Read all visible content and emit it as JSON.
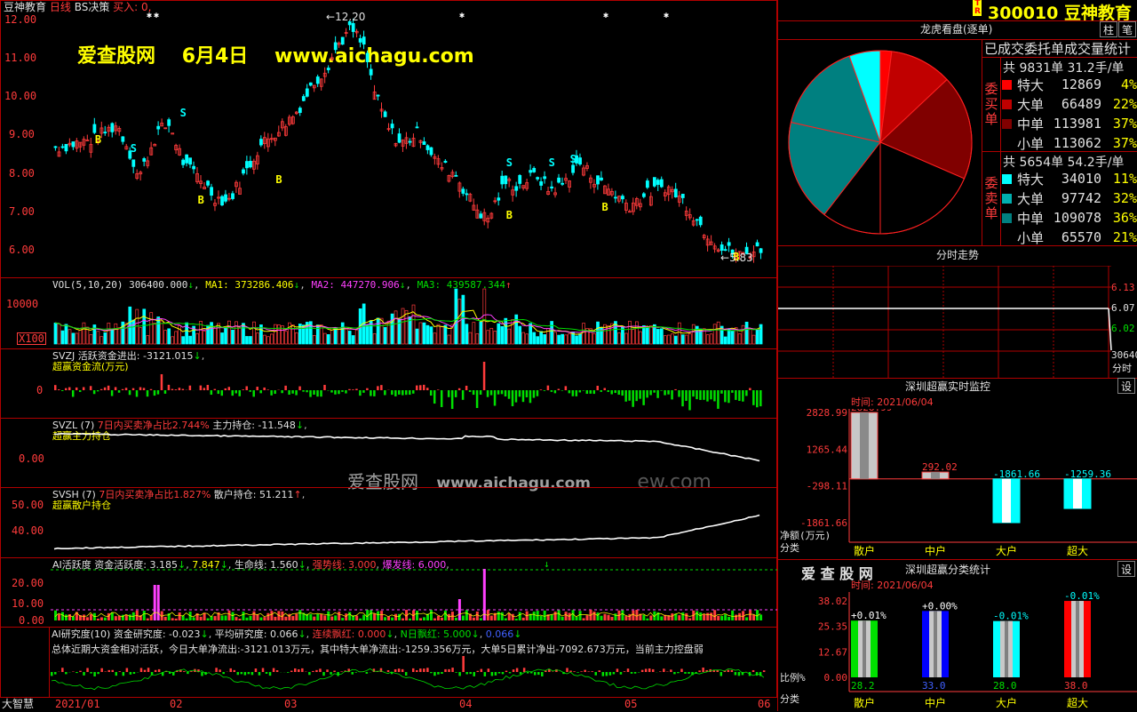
{
  "header": {
    "app": "豆神教育",
    "period": "日线",
    "indicator": "BS决策",
    "buy_label": "买入: 0,",
    "watermark_site": "爱查股网",
    "watermark_date": "6月4日",
    "watermark_url": "www.aichagu.com",
    "center_watermark_site": "爱查股网",
    "center_watermark_url": "www.aichagu.com",
    "center_watermark_tail": "ew.com"
  },
  "price_axis": [
    "12.00",
    "11.00",
    "10.00",
    "9.00",
    "8.00",
    "7.00",
    "6.00"
  ],
  "price_labels": {
    "high": "12.20",
    "low": "5.83"
  },
  "vol": {
    "title": "VOL(5,10,20)",
    "value": "306400.000",
    "ma1": "MA1: 373286.406",
    "ma2": "MA2: 447270.906",
    "ma3": "MA3: 439587.344",
    "axis_top": "10000",
    "axis_unit": "X100"
  },
  "svzj": {
    "title": "SVZJ",
    "label": "活跃资金进出: -3121.015",
    "sub": "超赢资金流(万元)",
    "axis": "0"
  },
  "svzl": {
    "title": "SVZL (7)",
    "ratio": "7日内买卖净占比2.744%",
    "hold": "主力持仓: -11.548",
    "sub": "超赢主力持仓",
    "axis": "0.00"
  },
  "svsh": {
    "title": "SVSH (7)",
    "ratio": "7日内买卖净占比1.827%",
    "hold": "散户持仓: 51.211",
    "sub": "超赢散户持仓",
    "axis": [
      "50.00",
      "40.00"
    ]
  },
  "ai": {
    "title": "AI活跃度",
    "activity": "资金活跃度: 3.185",
    "v2": "7.847",
    "life": "生命线: 1.560",
    "strong": "强势线: 3.000",
    "burst": "爆发线: 6.000",
    "axis": [
      "20.00",
      "10.00",
      "0.00"
    ]
  },
  "research": {
    "title": "AI研究度(10)",
    "deg": "资金研究度: -0.023",
    "avg": "平均研究度: 0.066",
    "lianxu": "连续飘红: 0.000",
    "nday": "N日飘红: 5.000",
    "val": "0.066",
    "summary": "总体近期大资金相对活跃，今日大单净流出:-3121.013万元，其中特大单净流出:-1259.356万元，大单5日累计净出-7092.673万元，当前主力控盘弱"
  },
  "date_axis": [
    "2021/01",
    "02",
    "03",
    "04",
    "05",
    "06"
  ],
  "brand": "大智慧",
  "right": {
    "code": "300010",
    "name": "豆神教育",
    "tab_label": "龙虎看盘(逐单)",
    "btn1": "柱",
    "btn2": "笔",
    "stats_title": "已成交委托单成交量统计",
    "buy_side": "委买单",
    "sell_side": "委卖单",
    "buy_total": "共 9831单 31.2手/单",
    "sell_total": "共 5654单 54.2手/单",
    "buy_rows": [
      {
        "name": "特大",
        "vol": "12869",
        "pct": "4%",
        "color": "#ff0000"
      },
      {
        "name": "大单",
        "vol": "66489",
        "pct": "22%",
        "color": "#c00000"
      },
      {
        "name": "中单",
        "vol": "113981",
        "pct": "37%",
        "color": "#800000"
      },
      {
        "name": "小单",
        "vol": "113062",
        "pct": "37%",
        "color": "#000000"
      }
    ],
    "sell_rows": [
      {
        "name": "特大",
        "vol": "34010",
        "pct": "11%",
        "color": "#00ffff"
      },
      {
        "name": "大单",
        "vol": "97742",
        "pct": "32%",
        "color": "#00b0b0"
      },
      {
        "name": "中单",
        "vol": "109078",
        "pct": "36%",
        "color": "#008080"
      },
      {
        "name": "小单",
        "vol": "65570",
        "pct": "21%",
        "color": "#000000"
      }
    ],
    "intraday": {
      "title": "分时走势",
      "axis": [
        "6.13",
        "6.07",
        "6.02"
      ],
      "vol": "30640",
      "vol_label": "分时"
    },
    "monitor": {
      "title": "深圳超赢实时监控",
      "set": "设",
      "time": "时间: 2021/06/04",
      "axis": [
        "2828.99",
        "1265.44",
        "-298.11",
        "-1861.66"
      ],
      "ylabel": "净额(万元)",
      "xlabel": "分类",
      "bars": [
        {
          "label": "散户",
          "value": "2828.99"
        },
        {
          "label": "中户",
          "value": "292.02"
        },
        {
          "label": "大户",
          "value": "-1861.66"
        },
        {
          "label": "超大",
          "value": "-1259.36"
        }
      ]
    },
    "classify": {
      "brand": "爱 查 股 网",
      "title": "深圳超赢分类统计",
      "set": "设",
      "time": "时间: 2021/06/04",
      "axis": [
        "38.02",
        "25.35",
        "12.67",
        "0.00"
      ],
      "ylabel": "比例%",
      "xlabel": "分类",
      "bars": [
        {
          "label": "散户",
          "value": "28.2",
          "change": "+0.01%",
          "color": "#00e000"
        },
        {
          "label": "中户",
          "value": "33.0",
          "change": "+0.00%",
          "color": "#0000ff"
        },
        {
          "label": "大户",
          "value": "28.0",
          "change": "-0.01%",
          "color": "#00ffff"
        },
        {
          "label": "超大",
          "value": "38.0",
          "change": "-0.01%",
          "color": "#ff0000"
        }
      ]
    }
  },
  "chart_data": [
    {
      "type": "pie",
      "title": "龙虎看盘(逐单)",
      "categories": [
        "买特大",
        "买大单",
        "买中单",
        "买小单",
        "卖小单",
        "卖中单",
        "卖大单",
        "卖特大"
      ],
      "values": [
        4,
        22,
        37,
        37,
        21,
        36,
        32,
        11
      ]
    },
    {
      "type": "bar",
      "title": "深圳超赢实时监控",
      "categories": [
        "散户",
        "中户",
        "大户",
        "超大"
      ],
      "values": [
        2828.99,
        292.02,
        -1861.66,
        -1259.36
      ],
      "ylim": [
        -1861.66,
        2828.99
      ]
    },
    {
      "type": "bar",
      "title": "深圳超赢分类统计",
      "categories": [
        "散户",
        "中户",
        "大户",
        "超大"
      ],
      "values": [
        28.2,
        33.0,
        28.0,
        38.0
      ],
      "ylim": [
        0,
        38.02
      ]
    }
  ]
}
